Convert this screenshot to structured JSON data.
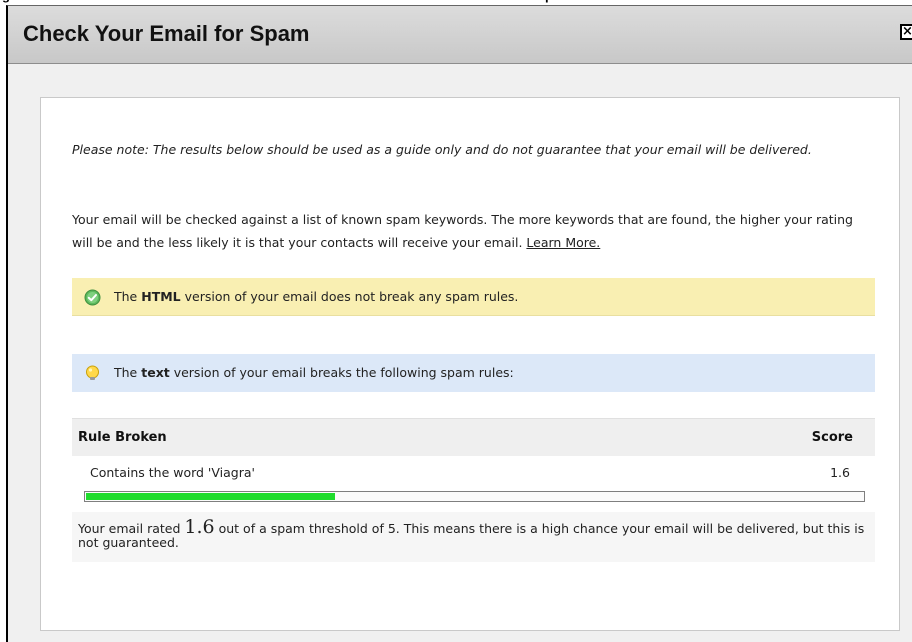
{
  "dialog": {
    "title": "Check Your Email for Spam",
    "close_glyph": "×"
  },
  "note": "Please note: The results below should be used as a guide only and do not guarantee that your email will be delivered.",
  "intro": {
    "text": "Your email will be checked against a list of known spam keywords. The more keywords that are found, the higher your rating will be and the less likely it is that your contacts will receive your email. ",
    "link": "Learn More."
  },
  "html_check": {
    "prefix": "The ",
    "bold": "HTML",
    "suffix": " version of your email does not break any spam rules.",
    "icon": "check-circle-icon",
    "color": "#f9efb2"
  },
  "text_check": {
    "prefix": "The ",
    "bold": "text",
    "suffix": " version of your email breaks the following spam rules:",
    "icon": "lightbulb-icon",
    "color": "#dce8f8"
  },
  "rules_table": {
    "headers": [
      "Rule Broken",
      "Score"
    ],
    "rows": [
      {
        "rule": "Contains the word 'Viagra'",
        "score": "1.6"
      }
    ]
  },
  "spam_meter": {
    "score": 1.6,
    "threshold": 5,
    "fill_color": "#1fdc2c"
  },
  "summary": {
    "prefix": "Your email rated ",
    "score": "1.6",
    "suffix": " out of a spam threshold of 5. This means there is a high chance your email will be delivered, but this is not guaranteed."
  }
}
